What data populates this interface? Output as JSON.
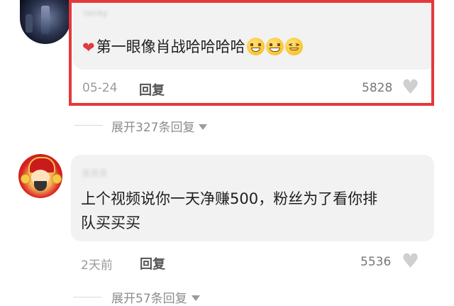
{
  "comments": [
    {
      "username": "rocky",
      "text": "第一眼像肖战哈哈哈哈",
      "date": "05-24",
      "reply_label": "回复",
      "likes": "5828",
      "expand_label": "展开327条回复"
    },
    {
      "username": "贝贝贝",
      "text_line1": "上个视频说你一天净赚500，粉丝为了看你排",
      "text_line2": "队买买买",
      "date": "2天前",
      "reply_label": "回复",
      "likes": "5536",
      "expand_label": "展开57条回复"
    }
  ],
  "colors": {
    "highlight": "#e5383b",
    "heart": "#e23b3b"
  },
  "icons": [
    "heart-emoji-icon",
    "drooling-emoji-icon",
    "grin-emoji-icon",
    "smile-emoji-icon",
    "like-heart-icon",
    "expand-caret-icon"
  ]
}
